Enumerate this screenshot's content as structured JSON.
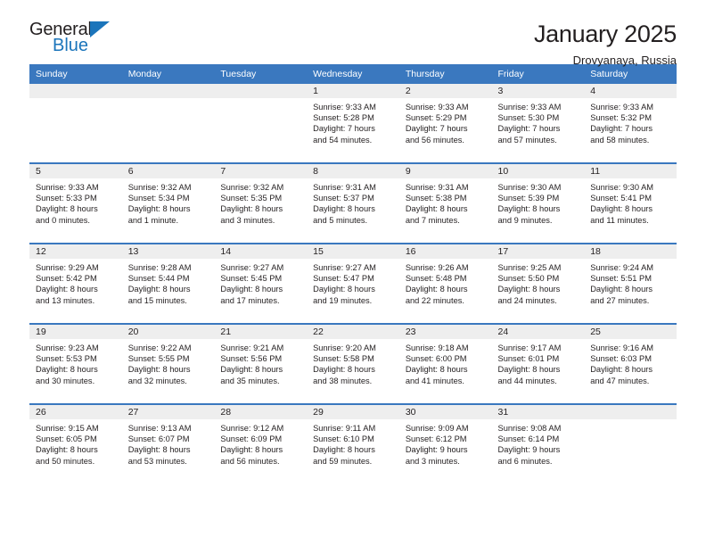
{
  "brand": {
    "name_line1": "General",
    "name_line2": "Blue",
    "triangle_icon": "triangle-icon",
    "accent_color": "#1b75bb"
  },
  "header": {
    "title": "January 2025",
    "subtitle": "Drovyanaya, Russia"
  },
  "theme": {
    "header_row_bg": "#3a78bf",
    "date_band_bg": "#eeeeee",
    "text_color": "#231f20",
    "separator_color": "#3a78bf"
  },
  "weekday_headers": [
    "Sunday",
    "Monday",
    "Tuesday",
    "Wednesday",
    "Thursday",
    "Friday",
    "Saturday"
  ],
  "weeks": [
    [
      {
        "date": "",
        "lines": []
      },
      {
        "date": "",
        "lines": []
      },
      {
        "date": "",
        "lines": []
      },
      {
        "date": "1",
        "lines": [
          "Sunrise: 9:33 AM",
          "Sunset: 5:28 PM",
          "Daylight: 7 hours",
          "and 54 minutes."
        ]
      },
      {
        "date": "2",
        "lines": [
          "Sunrise: 9:33 AM",
          "Sunset: 5:29 PM",
          "Daylight: 7 hours",
          "and 56 minutes."
        ]
      },
      {
        "date": "3",
        "lines": [
          "Sunrise: 9:33 AM",
          "Sunset: 5:30 PM",
          "Daylight: 7 hours",
          "and 57 minutes."
        ]
      },
      {
        "date": "4",
        "lines": [
          "Sunrise: 9:33 AM",
          "Sunset: 5:32 PM",
          "Daylight: 7 hours",
          "and 58 minutes."
        ]
      }
    ],
    [
      {
        "date": "5",
        "lines": [
          "Sunrise: 9:33 AM",
          "Sunset: 5:33 PM",
          "Daylight: 8 hours",
          "and 0 minutes."
        ]
      },
      {
        "date": "6",
        "lines": [
          "Sunrise: 9:32 AM",
          "Sunset: 5:34 PM",
          "Daylight: 8 hours",
          "and 1 minute."
        ]
      },
      {
        "date": "7",
        "lines": [
          "Sunrise: 9:32 AM",
          "Sunset: 5:35 PM",
          "Daylight: 8 hours",
          "and 3 minutes."
        ]
      },
      {
        "date": "8",
        "lines": [
          "Sunrise: 9:31 AM",
          "Sunset: 5:37 PM",
          "Daylight: 8 hours",
          "and 5 minutes."
        ]
      },
      {
        "date": "9",
        "lines": [
          "Sunrise: 9:31 AM",
          "Sunset: 5:38 PM",
          "Daylight: 8 hours",
          "and 7 minutes."
        ]
      },
      {
        "date": "10",
        "lines": [
          "Sunrise: 9:30 AM",
          "Sunset: 5:39 PM",
          "Daylight: 8 hours",
          "and 9 minutes."
        ]
      },
      {
        "date": "11",
        "lines": [
          "Sunrise: 9:30 AM",
          "Sunset: 5:41 PM",
          "Daylight: 8 hours",
          "and 11 minutes."
        ]
      }
    ],
    [
      {
        "date": "12",
        "lines": [
          "Sunrise: 9:29 AM",
          "Sunset: 5:42 PM",
          "Daylight: 8 hours",
          "and 13 minutes."
        ]
      },
      {
        "date": "13",
        "lines": [
          "Sunrise: 9:28 AM",
          "Sunset: 5:44 PM",
          "Daylight: 8 hours",
          "and 15 minutes."
        ]
      },
      {
        "date": "14",
        "lines": [
          "Sunrise: 9:27 AM",
          "Sunset: 5:45 PM",
          "Daylight: 8 hours",
          "and 17 minutes."
        ]
      },
      {
        "date": "15",
        "lines": [
          "Sunrise: 9:27 AM",
          "Sunset: 5:47 PM",
          "Daylight: 8 hours",
          "and 19 minutes."
        ]
      },
      {
        "date": "16",
        "lines": [
          "Sunrise: 9:26 AM",
          "Sunset: 5:48 PM",
          "Daylight: 8 hours",
          "and 22 minutes."
        ]
      },
      {
        "date": "17",
        "lines": [
          "Sunrise: 9:25 AM",
          "Sunset: 5:50 PM",
          "Daylight: 8 hours",
          "and 24 minutes."
        ]
      },
      {
        "date": "18",
        "lines": [
          "Sunrise: 9:24 AM",
          "Sunset: 5:51 PM",
          "Daylight: 8 hours",
          "and 27 minutes."
        ]
      }
    ],
    [
      {
        "date": "19",
        "lines": [
          "Sunrise: 9:23 AM",
          "Sunset: 5:53 PM",
          "Daylight: 8 hours",
          "and 30 minutes."
        ]
      },
      {
        "date": "20",
        "lines": [
          "Sunrise: 9:22 AM",
          "Sunset: 5:55 PM",
          "Daylight: 8 hours",
          "and 32 minutes."
        ]
      },
      {
        "date": "21",
        "lines": [
          "Sunrise: 9:21 AM",
          "Sunset: 5:56 PM",
          "Daylight: 8 hours",
          "and 35 minutes."
        ]
      },
      {
        "date": "22",
        "lines": [
          "Sunrise: 9:20 AM",
          "Sunset: 5:58 PM",
          "Daylight: 8 hours",
          "and 38 minutes."
        ]
      },
      {
        "date": "23",
        "lines": [
          "Sunrise: 9:18 AM",
          "Sunset: 6:00 PM",
          "Daylight: 8 hours",
          "and 41 minutes."
        ]
      },
      {
        "date": "24",
        "lines": [
          "Sunrise: 9:17 AM",
          "Sunset: 6:01 PM",
          "Daylight: 8 hours",
          "and 44 minutes."
        ]
      },
      {
        "date": "25",
        "lines": [
          "Sunrise: 9:16 AM",
          "Sunset: 6:03 PM",
          "Daylight: 8 hours",
          "and 47 minutes."
        ]
      }
    ],
    [
      {
        "date": "26",
        "lines": [
          "Sunrise: 9:15 AM",
          "Sunset: 6:05 PM",
          "Daylight: 8 hours",
          "and 50 minutes."
        ]
      },
      {
        "date": "27",
        "lines": [
          "Sunrise: 9:13 AM",
          "Sunset: 6:07 PM",
          "Daylight: 8 hours",
          "and 53 minutes."
        ]
      },
      {
        "date": "28",
        "lines": [
          "Sunrise: 9:12 AM",
          "Sunset: 6:09 PM",
          "Daylight: 8 hours",
          "and 56 minutes."
        ]
      },
      {
        "date": "29",
        "lines": [
          "Sunrise: 9:11 AM",
          "Sunset: 6:10 PM",
          "Daylight: 8 hours",
          "and 59 minutes."
        ]
      },
      {
        "date": "30",
        "lines": [
          "Sunrise: 9:09 AM",
          "Sunset: 6:12 PM",
          "Daylight: 9 hours",
          "and 3 minutes."
        ]
      },
      {
        "date": "31",
        "lines": [
          "Sunrise: 9:08 AM",
          "Sunset: 6:14 PM",
          "Daylight: 9 hours",
          "and 6 minutes."
        ]
      },
      {
        "date": "",
        "lines": []
      }
    ]
  ]
}
